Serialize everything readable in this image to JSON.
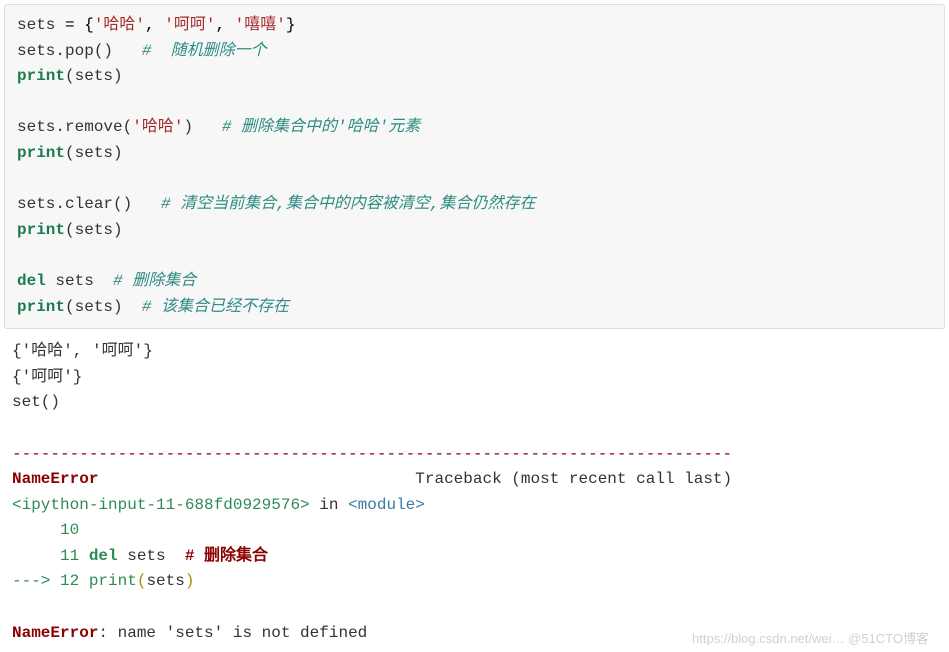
{
  "code": {
    "l1_var": "sets ",
    "l1_eq": "=",
    "l1_sp": " {",
    "l1_s1": "'哈哈'",
    "l1_c1": ", ",
    "l1_s2": "'呵呵'",
    "l1_c2": ", ",
    "l1_s3": "'嘻嘻'",
    "l1_close": "}",
    "l2_a": "sets.pop()   ",
    "l2_comment": "#  随机删除一个",
    "l3_print": "print",
    "l3_paren": "(sets)",
    "blank_line": "",
    "l5_a": "sets.remove(",
    "l5_s": "'哈哈'",
    "l5_b": ")   ",
    "l5_comment": "# 删除集合中的'哈哈'元素",
    "l6_print": "print",
    "l6_paren": "(sets)",
    "l8_a": "sets.clear()   ",
    "l8_comment": "# 清空当前集合,集合中的内容被清空,集合仍然存在",
    "l9_print": "print",
    "l9_paren": "(sets)",
    "l11_del": "del",
    "l11_rest": " sets  ",
    "l11_comment": "# 删除集合",
    "l12_print": "print",
    "l12_paren": "(sets)  ",
    "l12_comment": "# 该集合已经不存在"
  },
  "output": {
    "o1": "{'哈哈', '呵呵'}",
    "o2": "{'呵呵'}",
    "o3": "set()",
    "sep": "---------------------------------------------------------------------------",
    "err_name_a": "NameError",
    "err_tb": "                                 Traceback (most recent call last)",
    "err_loc_a": "<ipython-input-11-688fd0929576>",
    "err_loc_in": " in ",
    "err_loc_mod": "<module>",
    "err_l10": "     10 ",
    "err_l11_no": "     11 ",
    "err_l11_del": "del",
    "err_l11_rest": " sets  ",
    "err_l11_hash": "# 删除集合",
    "err_arrow": "---> ",
    "err_l12_no": "12 ",
    "err_l12_print": "print",
    "err_l12_op": "(",
    "err_l12_arg": "sets",
    "err_l12_cp": ")",
    "err_final_a": "NameError",
    "err_final_msg": ": name 'sets' is not defined"
  },
  "watermark": "https://blog.csdn.net/wei…    @51CTO博客"
}
